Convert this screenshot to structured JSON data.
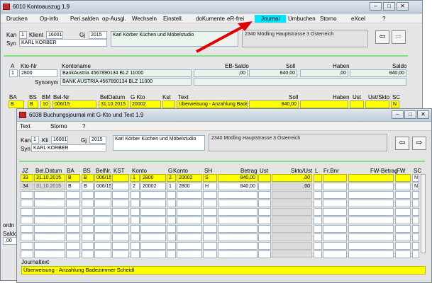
{
  "back": {
    "title": "6010 Kontoauszug 1.9",
    "menu": [
      "Drucken",
      "Op-info",
      "Peri.salden",
      "op-Ausgl.",
      "Wechseln",
      "Einstell.",
      "doKumente",
      "eR-frei",
      "Journal",
      "Umbuchen",
      "Storno",
      "eXcel",
      "?"
    ],
    "kan_label": "Kan",
    "kan": "1",
    "klient_label": "Klient",
    "klient": "16001",
    "gj_label": "Gj",
    "gj": "2015",
    "company": "Karl Körber Küchen und Möbelstudio",
    "address": "2340 Mödling Hauptstrasse 3 Österreich",
    "syn_label": "Syn",
    "syn": "KARL KÖRBER",
    "konto_headers": {
      "a": "A",
      "ktonr": "Kto-Nr",
      "kontoname": "Kontoname",
      "eb": "EB-Saldo",
      "soll": "Soll",
      "haben": "Haben",
      "saldo": "Saldo"
    },
    "konto": {
      "a": "1",
      "ktonr": "2800",
      "name": "BankAustria 4567890134 BLZ 11000",
      "eb": ",00",
      "soll": "840,00",
      "haben": ",00",
      "saldo": "840,00"
    },
    "synonym_label": "Synonym",
    "synonym": "BANK AUSTRIA 4567890134 BLZ 11000",
    "buch_headers": [
      "BA",
      "BS",
      "BM",
      "Bel-Nr",
      "BelDatum",
      "G Kto",
      "Kst",
      "Text",
      "Soll",
      "Haben",
      "Ust",
      "Ust/Skto",
      "SC"
    ],
    "buch": {
      "ba": "B",
      "bs": "B",
      "bm": "10",
      "belnr": "006/15",
      "datum": "31.10.2015",
      "gkto": "20002",
      "text": "Überweisung - Anzahlung Bade",
      "soll": "840,00",
      "sc": "N"
    },
    "side": {
      "l1": "ordn",
      "l2": "Saldo",
      "l3": ",00"
    }
  },
  "front": {
    "title": "6038 Buchungsjournal mit G-Kto und Text 1.9",
    "menu": [
      "Text",
      "Storno",
      "?"
    ],
    "kan_label": "Kan",
    "kan": "1",
    "kli_label": "Kli",
    "kli": "16001",
    "gj_label": "Gj",
    "gj": "2015",
    "company": "Karl Körber Küchen und Möbelstudio",
    "address": "2340 Mödling Hauptstrasse 3 Österreich",
    "syn_label": "Syn",
    "syn": "KARL KÖRBER",
    "headers": [
      "JZ",
      "Bel.Datum",
      "BA",
      "BS",
      "BelNr.",
      "KST",
      "Konto",
      "G",
      "Konto",
      "SH",
      "Betrag",
      "Ust",
      "Skto/Ust",
      "L",
      "Fr.Bnr",
      "FW-Betrag",
      "FW",
      "SC"
    ],
    "rows": [
      {
        "jz": "33",
        "datum": "31.10.2015",
        "ba": "B",
        "bs": "B",
        "belnr": "006/15",
        "konto_g": "1",
        "konto": "2800",
        "g": "2",
        "gkonto": "20002",
        "sh": "S",
        "betrag": "840,00",
        "skto": ",00",
        "sc": "N"
      },
      {
        "jz": "34",
        "datum": "31.10.2015",
        "ba": "B",
        "bs": "B",
        "belnr": "006/15",
        "konto_g": "2",
        "konto": "20002",
        "g": "1",
        "gkonto": "2800",
        "sh": "H",
        "betrag": "840,00",
        "skto": ",00",
        "sc": "N"
      }
    ],
    "journaltext_label": "Journaltext",
    "journaltext": "Überweisung - Anzahlung Badezimmer Scheidl"
  },
  "colors": {
    "highlight": "#ffff00",
    "menu_highlight": "#00e5ff",
    "arrow": "#e00000"
  },
  "icons": {
    "back": "arrow-left-icon",
    "forward": "arrow-right-icon"
  }
}
